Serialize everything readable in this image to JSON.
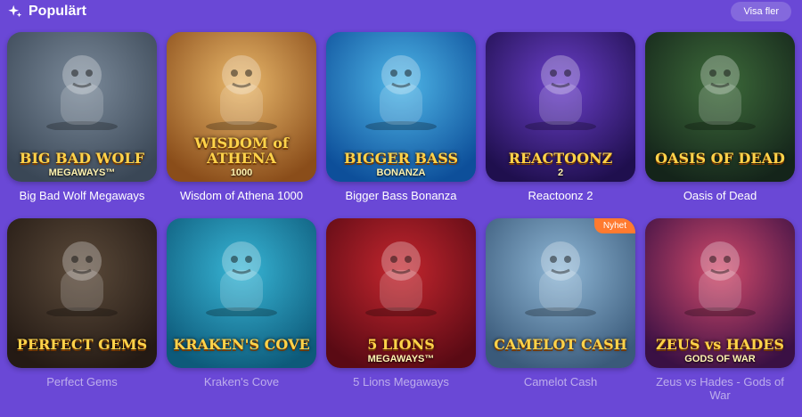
{
  "header": {
    "title": "Populärt",
    "more_label": "Visa fler",
    "accent": "#6a48d6"
  },
  "games": [
    {
      "name": "Big Bad Wolf Megaways",
      "art_title": "BIG BAD WOLF",
      "art_sub": "MEGAWAYS™",
      "bg1": "#7b8a9a",
      "bg2": "#3a4756",
      "icon": "wolf-icon"
    },
    {
      "name": "Wisdom of Athena 1000",
      "art_title": "WISDOM of ATHENA",
      "art_sub": "1000",
      "bg1": "#e9b86b",
      "bg2": "#8a4d1a",
      "icon": "warrior-icon"
    },
    {
      "name": "Bigger Bass Bonanza",
      "art_title": "BIGGER BASS",
      "art_sub": "BONANZA",
      "bg1": "#4fb7e8",
      "bg2": "#0d4f9a",
      "icon": "fish-icon"
    },
    {
      "name": "Reactoonz 2",
      "art_title": "REACTOONZ",
      "art_sub": "2",
      "bg1": "#6a3fc9",
      "bg2": "#1f0f4e",
      "icon": "alien-icon"
    },
    {
      "name": "Oasis of Dead",
      "art_title": "OASIS OF DEAD",
      "art_sub": "",
      "bg1": "#3d6b3a",
      "bg2": "#14241a",
      "icon": "pharaoh-icon"
    },
    {
      "name": "Perfect Gems",
      "art_title": "PERFECT GEMS",
      "art_sub": "",
      "bg1": "#5b4a3a",
      "bg2": "#241a14",
      "icon": "gem-icon"
    },
    {
      "name": "Kraken's Cove",
      "art_title": "KRAKEN'S COVE",
      "art_sub": "",
      "bg1": "#38b6d6",
      "bg2": "#0d5a7a",
      "icon": "pirate-icon"
    },
    {
      "name": "5 Lions Megaways",
      "art_title": "5 LIONS",
      "art_sub": "MEGAWAYS™",
      "bg1": "#c4262e",
      "bg2": "#5a0a14",
      "icon": "lion-icon"
    },
    {
      "name": "Camelot Cash",
      "art_title": "CAMELOT CASH",
      "art_sub": "",
      "bg1": "#8fb7d6",
      "bg2": "#3a5a7a",
      "icon": "king-icon",
      "badge": "Nyhet"
    },
    {
      "name": "Zeus vs Hades - Gods of War",
      "art_title": "ZEUS vs HADES",
      "art_sub": "GODS OF WAR",
      "bg1": "#d14a6a",
      "bg2": "#3a1044",
      "icon": "zeus-icon"
    }
  ]
}
